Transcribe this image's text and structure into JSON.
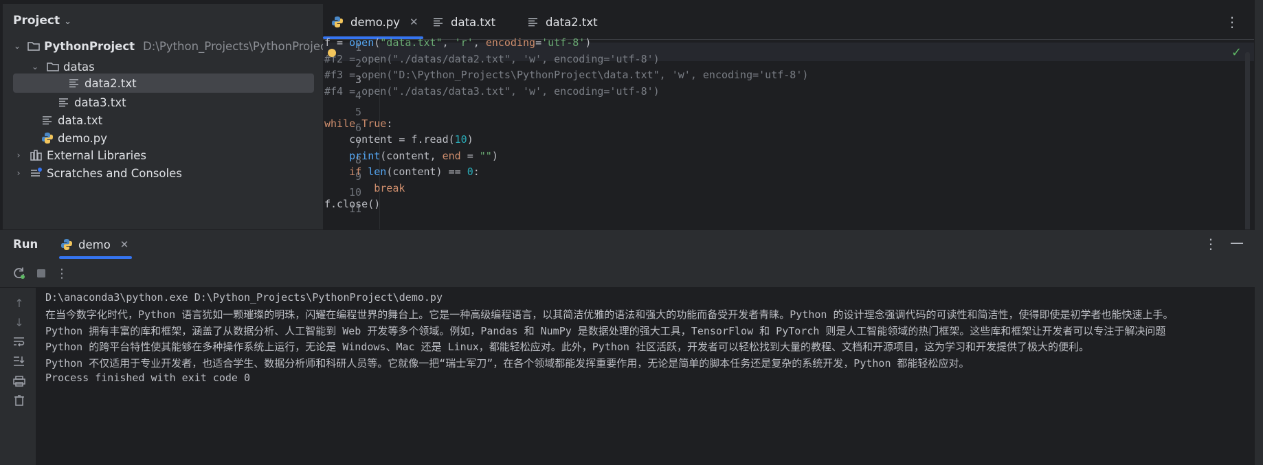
{
  "project": {
    "header": "Project",
    "tree": [
      {
        "label": "PythonProject",
        "path": "D:\\Python_Projects\\PythonProject",
        "icon": "folder-icon"
      },
      {
        "label": "datas",
        "icon": "folder-icon"
      },
      {
        "label": "data2.txt",
        "icon": "text-file-icon",
        "selected": true
      },
      {
        "label": "data3.txt",
        "icon": "text-file-icon"
      },
      {
        "label": "data.txt",
        "icon": "text-file-icon"
      },
      {
        "label": "demo.py",
        "icon": "python-file-icon"
      },
      {
        "label": "External Libraries",
        "icon": "library-icon"
      },
      {
        "label": "Scratches and Consoles",
        "icon": "scratches-icon"
      }
    ]
  },
  "editor": {
    "tabs": [
      {
        "label": "demo.py",
        "icon": "python-file-icon",
        "active": true
      },
      {
        "label": "data.txt",
        "icon": "text-file-icon"
      },
      {
        "label": "data2.txt",
        "icon": "text-file-icon"
      }
    ],
    "line_numbers": [
      "1",
      "2",
      "3",
      "4",
      "5",
      "6",
      "7",
      "8",
      "9",
      "10",
      "11"
    ],
    "current_line": "3"
  },
  "run": {
    "title": "Run",
    "tab_label": "demo",
    "console": [
      "D:\\anaconda3\\python.exe D:\\Python_Projects\\PythonProject\\demo.py",
      "在当今数字化时代，Python 语言犹如一颗璀璨的明珠，闪耀在编程世界的舞台上。它是一种高级编程语言，以其简洁优雅的语法和强大的功能而备受开发者青睐。Python 的设计理念强调代码的可读性和简洁性，使得即使是初学者也能快速上手。",
      "Python 拥有丰富的库和框架，涵盖了从数据分析、人工智能到 Web 开发等多个领域。例如，Pandas 和 NumPy 是数据处理的强大工具，TensorFlow 和 PyTorch 则是人工智能领域的热门框架。这些库和框架让开发者可以专注于解决问题",
      "Python 的跨平台特性使其能够在多种操作系统上运行，无论是 Windows、Mac 还是 Linux，都能轻松应对。此外，Python 社区活跃，开发者可以轻松找到大量的教程、文档和开源项目，这为学习和开发提供了极大的便利。",
      "Python 不仅适用于专业开发者，也适合学生、数据分析师和科研人员等。它就像一把“瑞士军刀”，在各个领域都能发挥重要作用，无论是简单的脚本任务还是复杂的系统开发，Python 都能轻松应对。",
      "Process finished with exit code 0"
    ]
  },
  "code": {
    "l1": {
      "a": "f = ",
      "b": "open",
      "c": "(",
      "d": "\"data.txt\"",
      "e": ", ",
      "f": "'r'",
      "g": ", ",
      "h": "encoding",
      "i": "=",
      "j": "'utf-8'",
      "k": ")"
    },
    "l2": "#f2 = open(\"./datas/data2.txt\", 'w', encoding='utf-8')",
    "l3": "#f3 = open(\"D:\\Python_Projects\\PythonProject\\data.txt\", 'w', encoding='utf-8')",
    "l4": "#f4 = open(\"./datas/data3.txt\", 'w', encoding='utf-8')",
    "l6": {
      "a": "while",
      "b": " ",
      "c": "True",
      "d": ":"
    },
    "l7": {
      "a": "    content = f.read(",
      "b": "10",
      "c": ")"
    },
    "l8": {
      "a": "    ",
      "b": "print",
      "c": "(content, ",
      "d": "end",
      "e": " = ",
      "f": "\"\"",
      "g": ")"
    },
    "l9": {
      "a": "    ",
      "b": "if",
      "c": " ",
      "d": "len",
      "e": "(content) == ",
      "f": "0",
      "g": ":"
    },
    "l10": {
      "a": "        ",
      "b": "break"
    },
    "l11": "f.close()"
  },
  "colors": {
    "accent": "#3574f0",
    "keyword": "#cf8e6d",
    "function": "#56a8f5",
    "string": "#6aab73",
    "number": "#2aacb8",
    "comment": "#7a7e85",
    "ok": "#5fb865"
  }
}
